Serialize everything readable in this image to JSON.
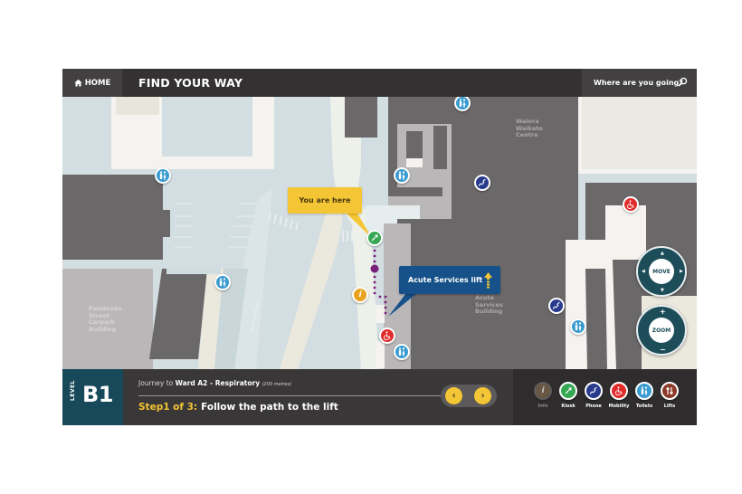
{
  "header": {
    "home_label": "HOME",
    "title": "FIND YOUR WAY",
    "search_label": "Where are you going?",
    "icons": {
      "home": "home-icon",
      "search": "search-icon"
    }
  },
  "map": {
    "you_are_here": "You are here",
    "lift_callout": "Acute Services lift",
    "buildings": [
      {
        "name": "Waiora Waikato Centre",
        "lines": [
          "Waiora",
          "Waikato",
          "Centre"
        ]
      },
      {
        "name": "Acute Services Building",
        "lines": [
          "Acute",
          "Services",
          "Building"
        ]
      },
      {
        "name": "Pembroke Street Carpark Building",
        "lines": [
          "Pembroke",
          "Street",
          "Carpark",
          "Building"
        ]
      }
    ],
    "street_label": "Pembroke Street",
    "pins": [
      {
        "type": "toilets",
        "icon": "toilets-icon"
      },
      {
        "type": "toilets",
        "icon": "toilets-icon"
      },
      {
        "type": "toilets",
        "icon": "toilets-icon"
      },
      {
        "type": "toilets",
        "icon": "toilets-icon"
      },
      {
        "type": "toilets",
        "icon": "toilets-icon"
      },
      {
        "type": "toilets",
        "icon": "toilets-icon"
      },
      {
        "type": "phone",
        "icon": "phone-icon"
      },
      {
        "type": "phone",
        "icon": "phone-icon"
      },
      {
        "type": "mobility",
        "icon": "wheelchair-icon"
      },
      {
        "type": "mobility",
        "icon": "wheelchair-icon"
      },
      {
        "type": "kiosk",
        "icon": "kiosk-icon"
      },
      {
        "type": "info",
        "icon": "info-icon",
        "glyph": "i"
      }
    ],
    "controls": {
      "move_label": "MOVE",
      "zoom_label": "ZOOM",
      "zoom_in": "+",
      "zoom_out": "−"
    },
    "colors": {
      "path": "#7a1f7a",
      "you_are_here": "#f4c534",
      "lift_callout": "#17518a",
      "building_dark": "#6b6869",
      "building_mid": "#b9b7b8",
      "open_space": "#d3dee2",
      "walkway": "#f4f3ef"
    }
  },
  "footer": {
    "level_word": "LEVEL",
    "level_value": "B1",
    "journey_prefix": "Journey to",
    "destination": "Ward A2 - Respiratory",
    "distance": "(200 metres)",
    "step_number": "Step1 of 3:",
    "step_text": "Follow the path to the lift",
    "step_current": 1,
    "step_total": 3,
    "prev_label": "‹",
    "next_label": "›",
    "legend": [
      {
        "label": "Info",
        "icon": "info-icon",
        "glyph": "i",
        "active": false
      },
      {
        "label": "Kiosk",
        "icon": "kiosk-icon",
        "active": true
      },
      {
        "label": "Phone",
        "icon": "phone-icon",
        "active": true
      },
      {
        "label": "Mobility",
        "icon": "wheelchair-icon",
        "active": true
      },
      {
        "label": "Toilets",
        "icon": "toilets-icon",
        "active": true
      },
      {
        "label": "Lifts",
        "icon": "lifts-icon",
        "active": true
      }
    ]
  }
}
